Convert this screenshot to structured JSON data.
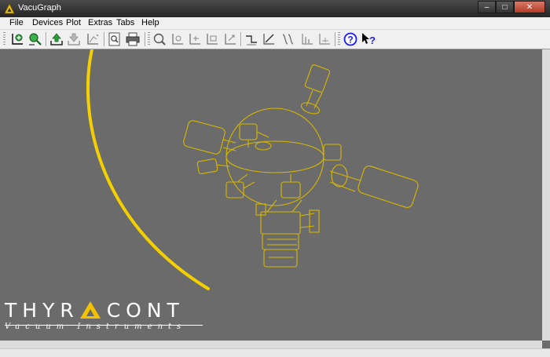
{
  "window": {
    "title": "VacuGraph"
  },
  "menu": {
    "items": [
      "File",
      "Devices",
      "Plot",
      "Extras",
      "Tabs",
      "Help"
    ]
  },
  "toolbar": {
    "buttons": [
      "add-graph-icon",
      "zoom-in-icon",
      "upload-icon",
      "download-icon",
      "axes-icon",
      "print-preview-icon",
      "print-icon",
      "zoom-icon",
      "axes-zoom-icon",
      "axes-move-icon",
      "axes-fit-icon",
      "axes-scale-icon",
      "step-icon",
      "slope-icon",
      "curves-icon",
      "bars-icon",
      "axes-reset-icon",
      "help-icon",
      "context-help-icon"
    ]
  },
  "logo": {
    "name_start": "THYR",
    "name_accent": "",
    "name_end": "CONT",
    "subtitle": "Vacuum Instruments"
  },
  "colors": {
    "accent": "#f2c200",
    "canvas": "#6b6b6b",
    "help": "#1a1aff"
  }
}
